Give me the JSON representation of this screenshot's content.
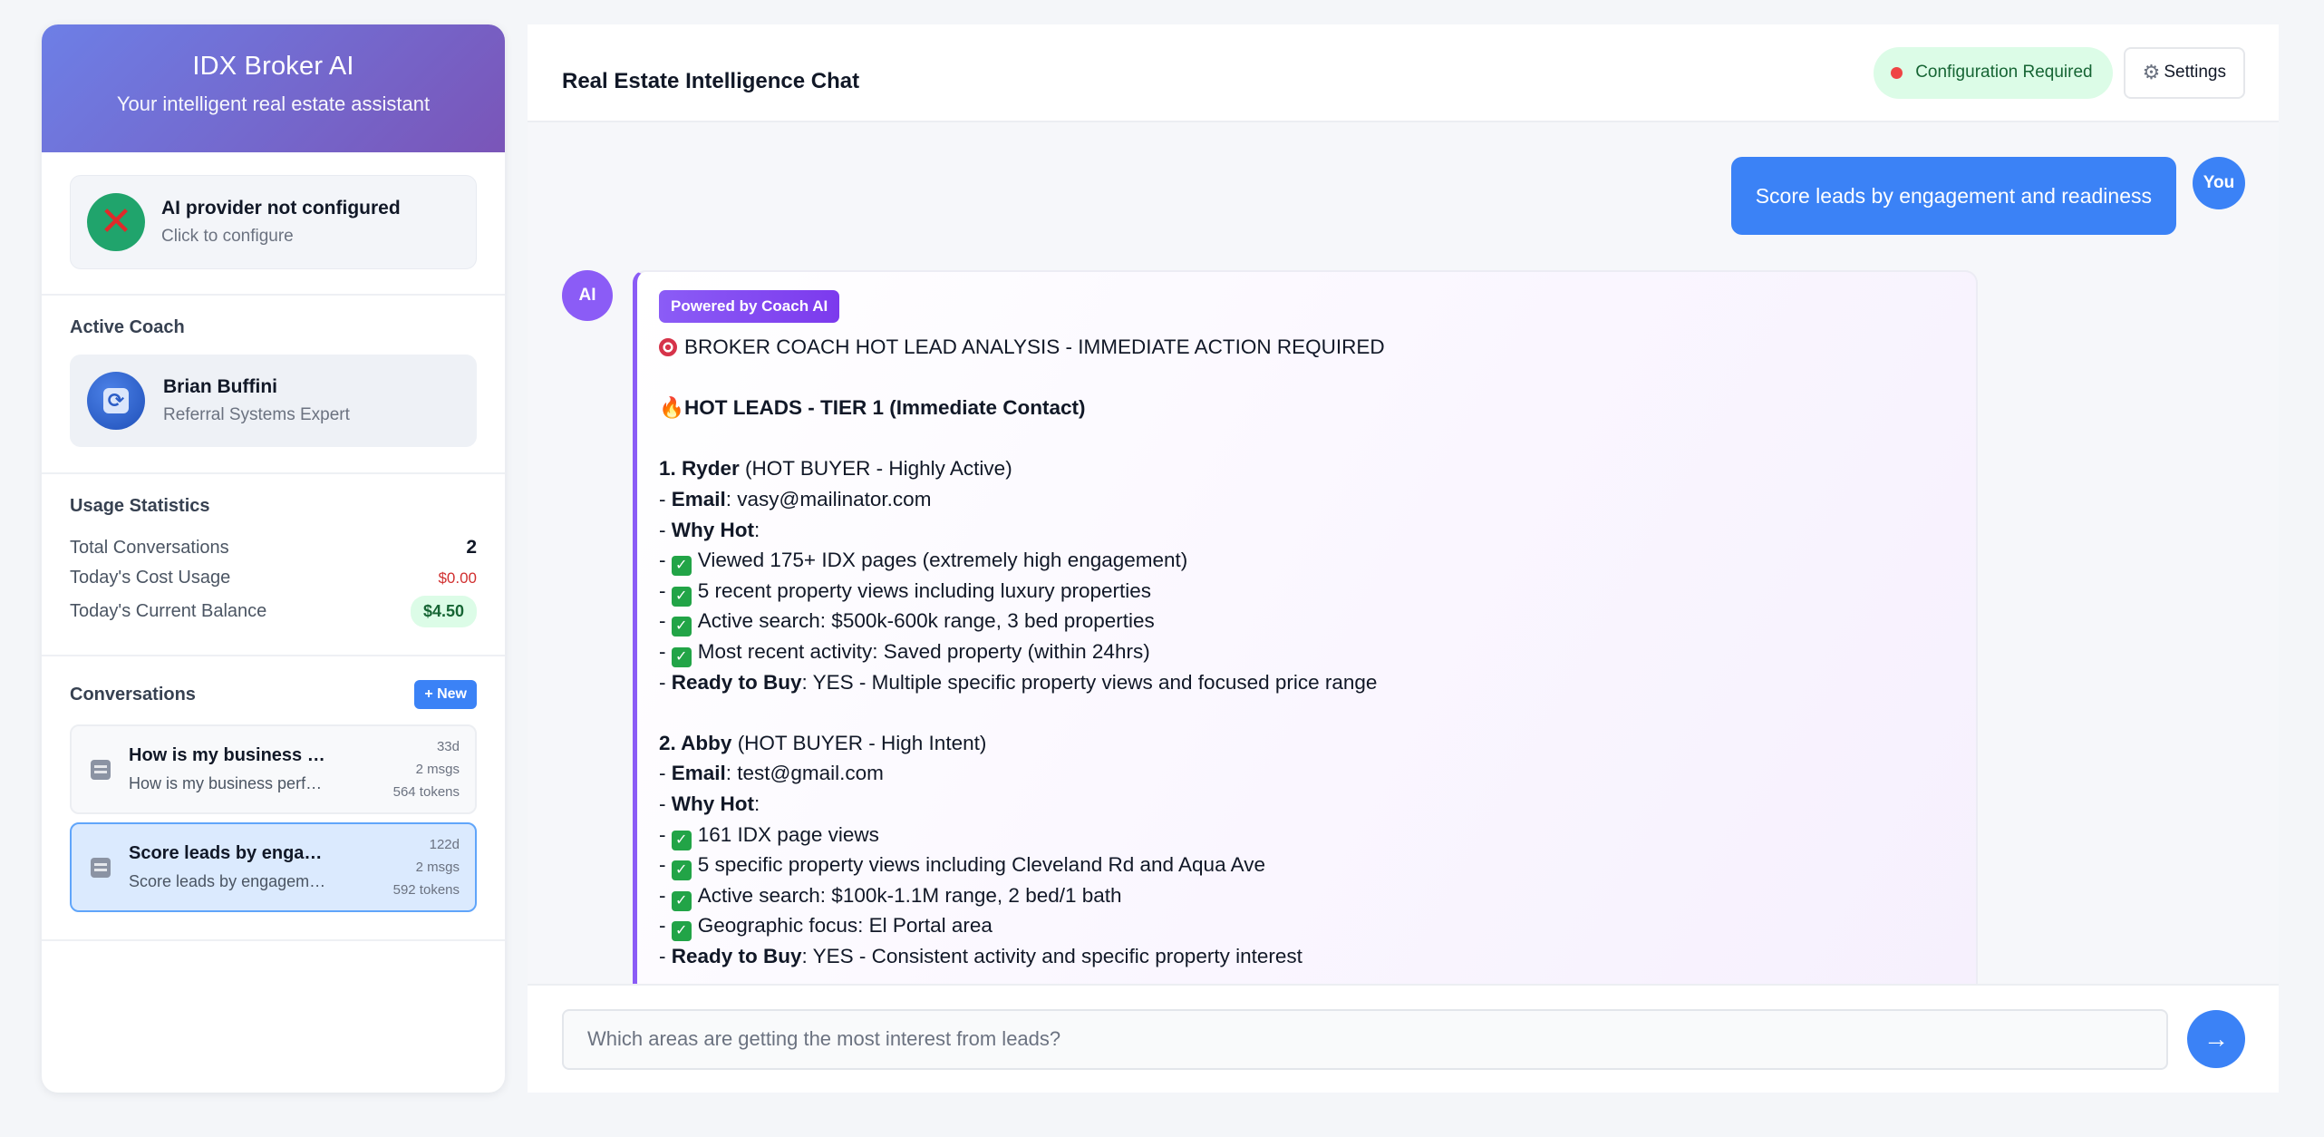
{
  "sidebar": {
    "title": "IDX Broker AI",
    "subtitle": "Your intelligent real estate assistant",
    "provider": {
      "title": "AI provider not configured",
      "subtitle": "Click to configure",
      "icon": "x-icon",
      "status_color": "#ef4444"
    },
    "coach": {
      "label": "Active Coach",
      "name": "Brian Buffini",
      "role": "Referral Systems Expert",
      "icon": "refresh-icon"
    },
    "usage": {
      "label": "Usage Statistics",
      "total_conversations_label": "Total Conversations",
      "total_conversations_value": "2",
      "cost_label": "Today's Cost Usage",
      "cost_value": "$0.00",
      "balance_label": "Today's Current Balance",
      "balance_value": "$4.50"
    },
    "conversations": {
      "label": "Conversations",
      "new_button": "+ New",
      "items": [
        {
          "title": "How is my business performing?",
          "preview": "How is my business performing?",
          "age": "33d",
          "msgs": "2 msgs",
          "tokens": "564 tokens",
          "active": false
        },
        {
          "title": "Score leads by engagement and readiness",
          "preview": "Score leads by engagement and readiness",
          "age": "122d",
          "msgs": "2 msgs",
          "tokens": "592 tokens",
          "active": true
        }
      ]
    }
  },
  "chat": {
    "title": "Real Estate Intelligence Chat",
    "status": "Configuration Required",
    "settings_label": "Settings",
    "user_message": "Score leads by engagement and readiness",
    "user_avatar": "You",
    "ai_avatar": "AI",
    "ai_badge": "Powered by Coach AI",
    "ai_lines": {
      "heading": "BROKER COACH HOT LEAD ANALYSIS - IMMEDIATE ACTION REQUIRED",
      "tier1": "HOT LEADS - TIER 1 (Immediate Contact)",
      "lead1_name": "1. Ryder",
      "lead1_tag": " (HOT BUYER - Highly Active)",
      "lead1_email_label": "Email",
      "lead1_email": ": vasy@mailinator.com",
      "why_hot": "Why Hot",
      "lead1_b1": "Viewed 175+ IDX pages (extremely high engagement)",
      "lead1_b2": "5 recent property views including luxury properties",
      "lead1_b3": "Active search: $500k-600k range, 3 bed properties",
      "lead1_b4": "Most recent activity: Saved property (within 24hrs)",
      "ready_label": "Ready to Buy",
      "lead1_ready": ": YES - Multiple specific property views and focused price range",
      "lead2_name": "2. Abby",
      "lead2_tag": " (HOT BUYER - High Intent)",
      "lead2_email": ": test@gmail.com",
      "lead2_b1": "161 IDX page views",
      "lead2_b2": "5 specific property views including Cleveland Rd and Aqua Ave",
      "lead2_b3": "Active search: $100k-1.1M range, 2 bed/1 bath",
      "lead2_b4": "Geographic focus: El Portal area",
      "lead2_ready": ": YES - Consistent activity and specific property interest"
    },
    "input_placeholder": "Which areas are getting the most interest from leads?",
    "send_icon": "arrow-right-icon"
  }
}
